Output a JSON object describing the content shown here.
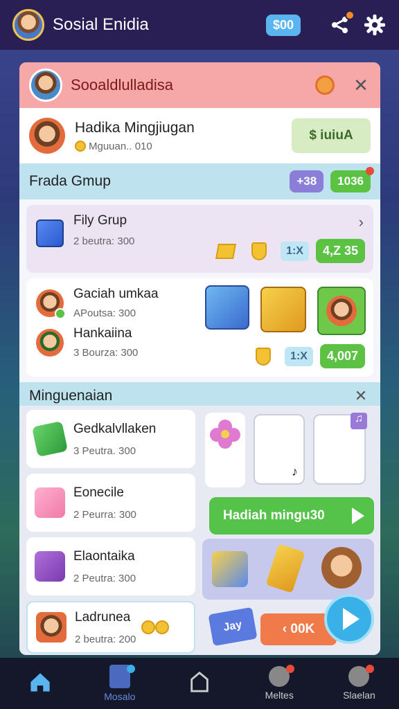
{
  "topbar": {
    "app_title": "Sosial Enidia",
    "coin_value": "$00"
  },
  "panel": {
    "header_title": "Sooaldlulladisa",
    "user": {
      "name": "Hadika Mingjiugan",
      "sub": "Mguuan.. 010",
      "button_label": "$ iuiuA"
    },
    "group_section": {
      "title": "Frada Gmup",
      "pill_purple": "+38",
      "pill_green": "1036"
    },
    "group_card": {
      "name": "Fily Grup",
      "sub": "2 beutra: 300",
      "tag": "1:X",
      "value": "4,Z 35"
    },
    "members_card": {
      "members": [
        {
          "name": "Gaciah umkaa",
          "sub": "APoutsa: 300"
        },
        {
          "name": "Hankaiina",
          "sub": "3 Bourza: 300"
        }
      ],
      "tag": "1:X",
      "value": "4,007"
    },
    "week_section": {
      "title": "Minguenaian"
    },
    "list": [
      {
        "name": "Gedkalvllaken",
        "sub": "3 Peutra. 300"
      },
      {
        "name": "Eonecile",
        "sub": "2 Peurra: 300"
      },
      {
        "name": "Elaontaika",
        "sub": "2 Peutra: 300"
      },
      {
        "name": "Ladrunea",
        "sub": "2 beutra: 200"
      }
    ],
    "cta_label": "Hadiah mingu30",
    "orange_button": "‹ 00K",
    "tag_label": "Jay"
  },
  "bottom_nav": [
    {
      "label": ""
    },
    {
      "label": "Mosalo"
    },
    {
      "label": ""
    },
    {
      "label": "Meltes"
    },
    {
      "label": "Slaelan"
    }
  ],
  "colors": {
    "accent_green": "#55c24a",
    "accent_blue": "#3ab0e8",
    "header_pink": "#f6a8a8",
    "section_blue": "#bfe2ef"
  }
}
